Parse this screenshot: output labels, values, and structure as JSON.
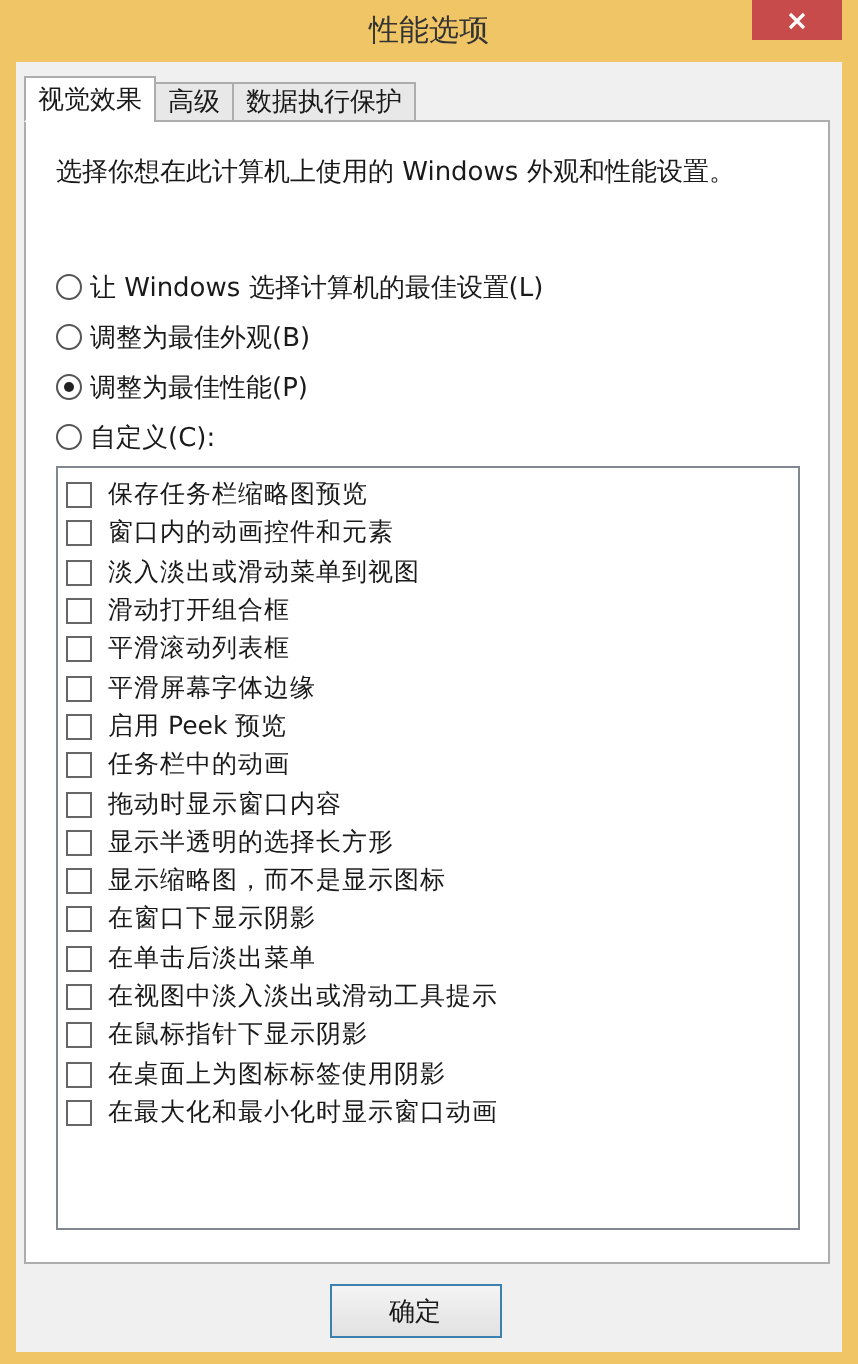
{
  "window": {
    "title": "性能选项"
  },
  "tabs": [
    {
      "label": "视觉效果",
      "selected": true
    },
    {
      "label": "高级",
      "selected": false
    },
    {
      "label": "数据执行保护",
      "selected": false
    }
  ],
  "description": "选择你想在此计算机上使用的 Windows 外观和性能设置。",
  "options": [
    {
      "label": "让 Windows 选择计算机的最佳设置(L)",
      "selected": false
    },
    {
      "label": "调整为最佳外观(B)",
      "selected": false
    },
    {
      "label": "调整为最佳性能(P)",
      "selected": true
    },
    {
      "label": "自定义(C):",
      "selected": false
    }
  ],
  "effects": [
    {
      "label": "保存任务栏缩略图预览",
      "checked": false
    },
    {
      "label": "窗口内的动画控件和元素",
      "checked": false
    },
    {
      "label": "淡入淡出或滑动菜单到视图",
      "checked": false
    },
    {
      "label": "滑动打开组合框",
      "checked": false
    },
    {
      "label": "平滑滚动列表框",
      "checked": false
    },
    {
      "label": "平滑屏幕字体边缘",
      "checked": false
    },
    {
      "label": "启用 Peek 预览",
      "checked": false
    },
    {
      "label": "任务栏中的动画",
      "checked": false
    },
    {
      "label": "拖动时显示窗口内容",
      "checked": false
    },
    {
      "label": "显示半透明的选择长方形",
      "checked": false
    },
    {
      "label": "显示缩略图，而不是显示图标",
      "checked": false
    },
    {
      "label": "在窗口下显示阴影",
      "checked": false
    },
    {
      "label": "在单击后淡出菜单",
      "checked": false
    },
    {
      "label": "在视图中淡入淡出或滑动工具提示",
      "checked": false
    },
    {
      "label": "在鼠标指针下显示阴影",
      "checked": false
    },
    {
      "label": "在桌面上为图标标签使用阴影",
      "checked": false
    },
    {
      "label": "在最大化和最小化时显示窗口动画",
      "checked": false
    }
  ],
  "buttons": [
    {
      "label": "确定"
    }
  ]
}
